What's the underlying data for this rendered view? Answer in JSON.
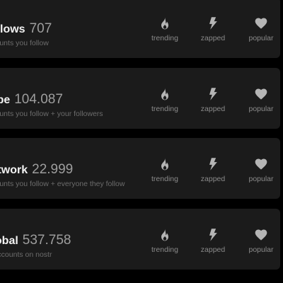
{
  "feeds": [
    {
      "name": "Follows",
      "count": "707",
      "description": "Accounts you follow",
      "metrics": [
        {
          "icon": "flame-icon",
          "label": "trending"
        },
        {
          "icon": "lightning-bolt-icon",
          "label": "zapped"
        },
        {
          "icon": "heart-icon",
          "label": "popular"
        }
      ]
    },
    {
      "name": "Tribe",
      "count": "104.087",
      "description": "Accounts you follow + your followers",
      "metrics": [
        {
          "icon": "flame-icon",
          "label": "trending"
        },
        {
          "icon": "lightning-bolt-icon",
          "label": "zapped"
        },
        {
          "icon": "heart-icon",
          "label": "popular"
        }
      ]
    },
    {
      "name": "Network",
      "count": "22.999",
      "description": "Accounts you follow + everyone they follow",
      "metrics": [
        {
          "icon": "flame-icon",
          "label": "trending"
        },
        {
          "icon": "lightning-bolt-icon",
          "label": "zapped"
        },
        {
          "icon": "heart-icon",
          "label": "popular"
        }
      ]
    },
    {
      "name": "Global",
      "count": "537.758",
      "description": "All accounts on nostr",
      "metrics": [
        {
          "icon": "flame-icon",
          "label": "trending"
        },
        {
          "icon": "lightning-bolt-icon",
          "label": "zapped"
        },
        {
          "icon": "heart-icon",
          "label": "popular"
        }
      ]
    }
  ],
  "colors": {
    "background": "#000000",
    "card": "#1b1b1b",
    "name": "#f2f2f2",
    "count": "#9e9e9e",
    "description": "#6c6c6c",
    "icon": "#b5b5b5",
    "label": "#8a8a8a"
  }
}
